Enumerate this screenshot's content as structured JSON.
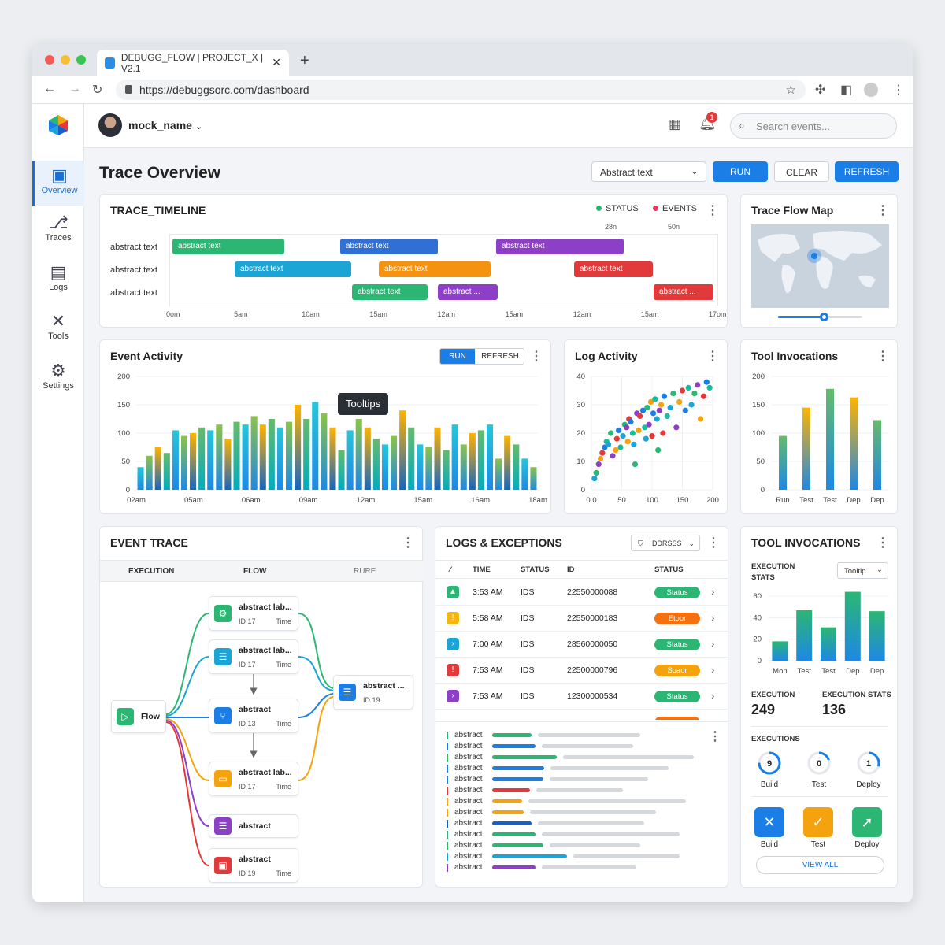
{
  "browser": {
    "tab_title": "DEBUGG_FLOW | PROJECT_X | V2.1",
    "url": "https://debuggsorc.com/dashboard"
  },
  "topbar": {
    "user": "mock_name",
    "search_placeholder": "Search events...",
    "notif_count": "1"
  },
  "sidebar": {
    "items": [
      {
        "label": "Overview",
        "icon": "grid-icon"
      },
      {
        "label": "Traces",
        "icon": "trace-icon"
      },
      {
        "label": "Logs",
        "icon": "logs-icon"
      },
      {
        "label": "Tools",
        "icon": "tools-icon"
      },
      {
        "label": "Settings",
        "icon": "gear-icon"
      }
    ]
  },
  "page": {
    "title": "Trace Overview",
    "select_value": "Abstract text",
    "run": "RUN",
    "clear": "CLEAR",
    "refresh": "REFRESH"
  },
  "timeline": {
    "title": "TRACE_TIMELINE",
    "legend": [
      {
        "label": "STATUS",
        "color": "#2bb673"
      },
      {
        "label": "EVENTS",
        "color": "#e8375d"
      }
    ],
    "top_ticks": [
      "28n",
      "50n"
    ],
    "row_labels": [
      "abstract text",
      "abstract text",
      "abstract text"
    ],
    "ticks": [
      "0om",
      "5am",
      "10am",
      "15am",
      "12am",
      "15am",
      "12am",
      "15am",
      "17om"
    ],
    "bars": [
      {
        "label": "abstract text",
        "color": "#2bb673"
      },
      {
        "label": "abstract text",
        "color": "#2f6fd6"
      },
      {
        "label": "abstract text",
        "color": "#8e3fc7"
      },
      {
        "label": "abstract text",
        "color": "#1aa5d6"
      },
      {
        "label": "abstract text",
        "color": "#f5920f"
      },
      {
        "label": "abstract text",
        "color": "#e23a3a"
      },
      {
        "label": "abstract text",
        "color": "#2bb673"
      },
      {
        "label": "abstract ...",
        "color": "#8e3fc7"
      },
      {
        "label": "abstract ...",
        "color": "#e23a3a"
      }
    ]
  },
  "flowmap": {
    "title": "Trace Flow Map",
    "slider_value": 0.55
  },
  "event_activity": {
    "title": "Event Activity",
    "run": "RUN",
    "refresh": "REFRESH",
    "tooltip": "Tooltips"
  },
  "log_activity": {
    "title": "Log Activity"
  },
  "tool_invocations_chart": {
    "title": "Tool Invocations"
  },
  "chart_data": [
    {
      "type": "bar",
      "title": "Event Activity",
      "ylim": [
        0,
        200
      ],
      "yticks": [
        "200",
        "150",
        "100",
        "50",
        "0"
      ],
      "xticks": [
        "02am",
        "05am",
        "06am",
        "09am",
        "12am",
        "15am",
        "16am",
        "18am"
      ],
      "series": [
        {
          "values": [
            40,
            60,
            75,
            65,
            105,
            95,
            100,
            110,
            105,
            115,
            90,
            120,
            115,
            130,
            115,
            125,
            110,
            120,
            150,
            125,
            155,
            135,
            110,
            70,
            105,
            125,
            110,
            90,
            80,
            95,
            140,
            110,
            80,
            75,
            110,
            70,
            115,
            80,
            100,
            105,
            115,
            55,
            95,
            80,
            55,
            40
          ]
        }
      ]
    },
    {
      "type": "scatter",
      "title": "Log Activity",
      "xlim": [
        0,
        200
      ],
      "ylim": [
        0,
        40
      ],
      "xticks": [
        "0 0",
        "50",
        "100",
        "150",
        "200"
      ],
      "yticks": [
        "40",
        "30",
        "20",
        "10",
        "0"
      ],
      "points": [
        [
          5,
          4
        ],
        [
          8,
          6
        ],
        [
          12,
          9
        ],
        [
          15,
          11
        ],
        [
          18,
          13
        ],
        [
          22,
          15
        ],
        [
          25,
          17
        ],
        [
          28,
          16
        ],
        [
          32,
          20
        ],
        [
          35,
          12
        ],
        [
          40,
          14
        ],
        [
          42,
          18
        ],
        [
          45,
          21
        ],
        [
          48,
          15
        ],
        [
          52,
          19
        ],
        [
          55,
          23
        ],
        [
          58,
          22
        ],
        [
          60,
          17
        ],
        [
          62,
          25
        ],
        [
          65,
          24
        ],
        [
          68,
          20
        ],
        [
          70,
          16
        ],
        [
          72,
          9
        ],
        [
          75,
          27
        ],
        [
          78,
          21
        ],
        [
          80,
          26
        ],
        [
          85,
          28
        ],
        [
          88,
          22
        ],
        [
          90,
          18
        ],
        [
          92,
          29
        ],
        [
          95,
          23
        ],
        [
          98,
          31
        ],
        [
          100,
          19
        ],
        [
          102,
          27
        ],
        [
          105,
          32
        ],
        [
          108,
          25
        ],
        [
          110,
          14
        ],
        [
          112,
          28
        ],
        [
          115,
          30
        ],
        [
          118,
          20
        ],
        [
          120,
          33
        ],
        [
          125,
          26
        ],
        [
          130,
          29
        ],
        [
          135,
          34
        ],
        [
          140,
          22
        ],
        [
          145,
          31
        ],
        [
          150,
          35
        ],
        [
          155,
          28
        ],
        [
          160,
          36
        ],
        [
          165,
          30
        ],
        [
          170,
          34
        ],
        [
          175,
          37
        ],
        [
          180,
          25
        ],
        [
          185,
          33
        ],
        [
          190,
          38
        ],
        [
          195,
          36
        ]
      ]
    },
    {
      "type": "bar",
      "title": "Tool Invocations",
      "ylim": [
        0,
        200
      ],
      "yticks": [
        "200",
        "150",
        "100",
        "50",
        "0"
      ],
      "categories": [
        "Run",
        "Test",
        "Test",
        "Dep",
        "Dep"
      ],
      "values": [
        95,
        145,
        178,
        163,
        123
      ]
    },
    {
      "type": "bar",
      "title": "Tool Invocations Stats",
      "ylim": [
        0,
        60
      ],
      "yticks": [
        "60",
        "40",
        "20",
        "0"
      ],
      "categories": [
        "Mon",
        "Test",
        "Test",
        "Dep",
        "Dep"
      ],
      "values": [
        18,
        47,
        31,
        64,
        46
      ]
    }
  ],
  "event_trace": {
    "title": "EVENT TRACE",
    "steps": [
      "EXECUTION",
      "FLOW",
      "RURE"
    ],
    "nodes": {
      "flow": "Flow",
      "n1": {
        "title": "abstract lab...",
        "id": "ID 17",
        "time": "Time"
      },
      "n2": {
        "title": "abstract lab...",
        "id": "ID 17",
        "time": "Time"
      },
      "n3": {
        "title": "abstract",
        "id": "ID 13",
        "time": "Time"
      },
      "n4": {
        "title": "abstract lab...",
        "id": "ID 17",
        "time": "Time"
      },
      "n5": {
        "title": "abstract"
      },
      "n6": {
        "title": "abstract",
        "id": "ID 19",
        "time": "Time"
      },
      "n7": {
        "title": "abstract ...",
        "id": "ID 19"
      }
    }
  },
  "logs": {
    "title": "LOGS & EXCEPTIONS",
    "filter": "DDRSSS",
    "headers": [
      "TIME",
      "STATUS",
      "ID",
      "STATUS"
    ],
    "rows": [
      {
        "time": "3:53 AM",
        "status": "IDS",
        "id": "22550000088",
        "pill": "Status",
        "color": "#2bb673",
        "icon_color": "#2bb673"
      },
      {
        "time": "5:58 AM",
        "status": "IDS",
        "id": "22550000183",
        "pill": "Etoor",
        "color": "#f5700f",
        "icon_color": "#f5b50f"
      },
      {
        "time": "7:00 AM",
        "status": "IDS",
        "id": "28560000050",
        "pill": "Status",
        "color": "#2bb673",
        "icon_color": "#1aa5d6"
      },
      {
        "time": "7:53 AM",
        "status": "IDS",
        "id": "22500000796",
        "pill": "Soaor",
        "color": "#f5a20f",
        "icon_color": "#e23a3a"
      },
      {
        "time": "7:53 AM",
        "status": "IDS",
        "id": "12300000534",
        "pill": "Status",
        "color": "#2bb673",
        "icon_color": "#8e3fc7"
      }
    ],
    "stream_label": "abstract"
  },
  "tools": {
    "title": "TOOL INVOCATIONS",
    "stats_label": "EXECUTION STATS",
    "tooltip": "Tooltip",
    "exec_label": "EXECUTION",
    "exec_value": "249",
    "exec_stats_label": "EXECUTION STATS",
    "exec_stats_value": "136",
    "executions_label": "EXECUTIONS",
    "rings": [
      {
        "value": "9",
        "label": "Build",
        "fraction": 0.75
      },
      {
        "value": "0",
        "label": "Test",
        "fraction": 0.2
      },
      {
        "value": "1",
        "label": "Deploy",
        "fraction": 0.3
      }
    ],
    "actions": [
      {
        "label": "Build",
        "color": "#1a7ee6"
      },
      {
        "label": "Test",
        "color": "#f5a20f"
      },
      {
        "label": "Deploy",
        "color": "#2bb673"
      }
    ],
    "view_all": "VIEW ALL"
  }
}
